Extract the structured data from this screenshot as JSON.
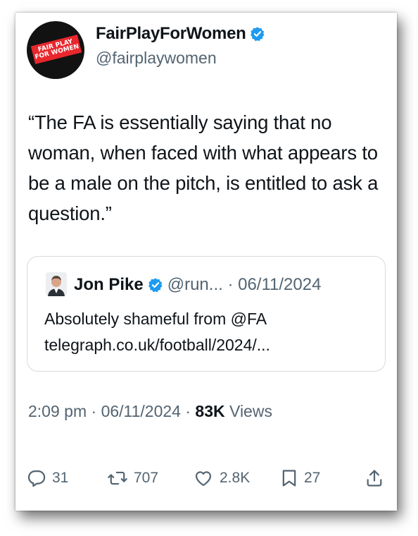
{
  "tweet": {
    "author_name": "FairPlayForWomen",
    "author_handle": "@fairplaywomen",
    "avatar_text": "FAIR PLAY FOR WOMEN",
    "text": "“The FA is essentially saying that no woman, when faced with what appears to be a male on the pitch, is entitled to ask a question.”",
    "time": "2:09 pm",
    "date": "06/11/2024",
    "separator": "·",
    "views_count": "83K",
    "views_label": "Views"
  },
  "quote": {
    "author_name": "Jon Pike",
    "meta": "@run... · 06/11/2024",
    "line1": "Absolutely shameful from @FA",
    "line2": "telegraph.co.uk/football/2024/..."
  },
  "actions": {
    "replies": "31",
    "reposts": "707",
    "likes": "2.8K",
    "bookmarks": "27"
  },
  "colors": {
    "verified": "#1d9bf0",
    "secondary_text": "#536471",
    "avatar_tag": "#e8272d"
  }
}
